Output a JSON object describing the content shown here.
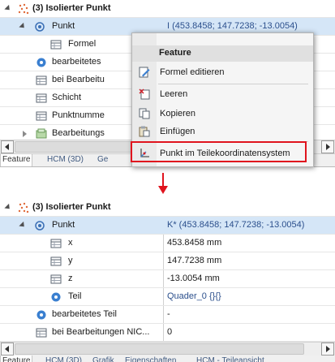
{
  "top": {
    "rows": [
      {
        "label": "(3) Isolierter Punkt",
        "value": ""
      },
      {
        "label": "Punkt",
        "value": "I  (453.8458; 147.7238; -13.0054)"
      },
      {
        "label": "Formel",
        "value": ""
      },
      {
        "label": "bearbeitetes",
        "value": ""
      },
      {
        "label": "bei Bearbeitu",
        "value": ""
      },
      {
        "label": "Schicht",
        "value": ""
      },
      {
        "label": "Punktnumme",
        "value": ""
      },
      {
        "label": "Bearbeitungs",
        "value": ""
      }
    ],
    "tabs": [
      "Feature",
      "HCM (3D)",
      "Ge"
    ]
  },
  "menu": {
    "header": "Feature",
    "items": [
      {
        "label": "Formel editieren",
        "icon": "edit-formula-icon"
      },
      {
        "label": "Leeren",
        "icon": "clear-icon"
      },
      {
        "label": "Kopieren",
        "icon": "copy-icon"
      },
      {
        "label": "Einfügen",
        "icon": "paste-icon"
      },
      {
        "label": "Punkt im Teilekoordinatensystem",
        "icon": "part-coordinate-icon"
      }
    ],
    "highlight_color": "#e0141e"
  },
  "bottom": {
    "rows": [
      {
        "label": "(3) Isolierter Punkt",
        "value": ""
      },
      {
        "label": "Punkt",
        "value": "K* (453.8458; 147.7238; -13.0054)"
      },
      {
        "label": "x",
        "value": "453.8458 mm"
      },
      {
        "label": "y",
        "value": "147.7238 mm"
      },
      {
        "label": "z",
        "value": "-13.0054 mm"
      },
      {
        "label": "Teil",
        "value": "Quader_0 {}{}"
      },
      {
        "label": "bearbeitetes Teil",
        "value": "-"
      },
      {
        "label": "bei Bearbeitungen NIC...",
        "value": "0"
      }
    ],
    "tabs": [
      "Feature",
      "HCM (3D)",
      "Grafik",
      "Eigenschaften",
      "HCM - Teileansicht"
    ]
  },
  "colors": {
    "selection": "#d5e6f7",
    "link": "#2b4f8c",
    "accent_red": "#e0141e"
  }
}
